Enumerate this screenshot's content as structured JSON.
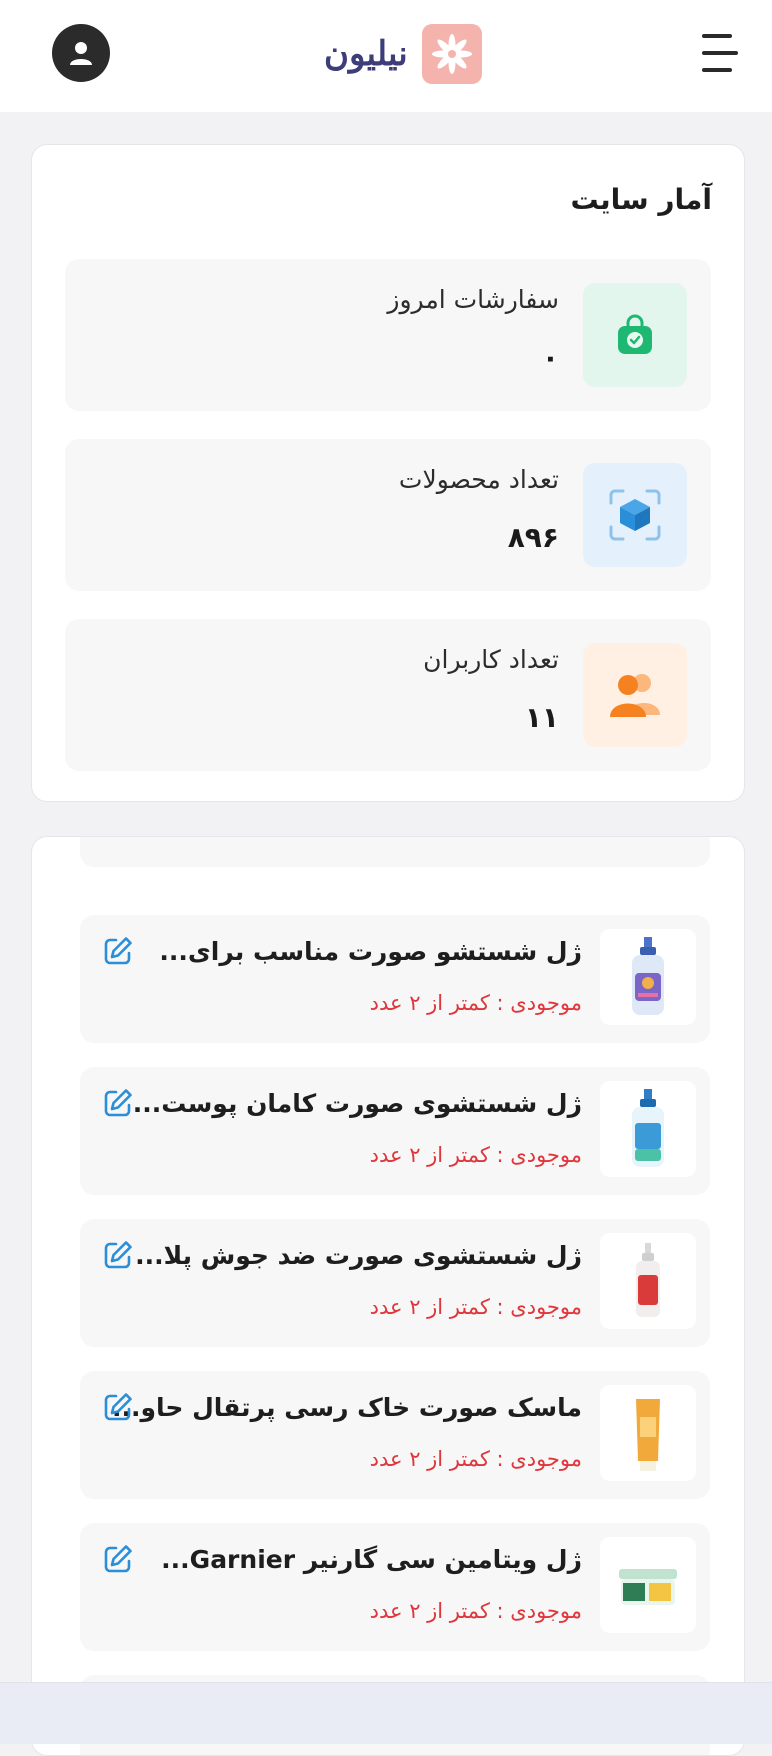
{
  "header": {
    "logo_text": "نیلیون"
  },
  "stats": {
    "title": "آمار سایت",
    "items": [
      {
        "label": "سفارشات امروز",
        "value": "۰",
        "icon": "shopping-bag-check-icon",
        "color": "#1fb873",
        "bg": "#e3f6ed"
      },
      {
        "label": "تعداد محصولات",
        "value": "۸۹۶",
        "icon": "box-icon",
        "color": "#2a8ed8",
        "bg": "#e4f0fb"
      },
      {
        "label": "تعداد کاربران",
        "value": "۱۱",
        "icon": "users-icon",
        "color": "#f58220",
        "bg": "#fff0e3"
      }
    ]
  },
  "low_stock": {
    "products": [
      {
        "name": "ژل شستشو صورت مناسب برای...",
        "stock": "موجودی : کمتر از ۲ عدد"
      },
      {
        "name": "ژل شستشوی صورت کامان پوست...",
        "stock": "موجودی : کمتر از ۲ عدد"
      },
      {
        "name": "ژل شستشوی صورت ضد جوش پلا...",
        "stock": "موجودی : کمتر از ۲ عدد"
      },
      {
        "name": "ماسک صورت خاک رسی پرتقال حاو...",
        "stock": "موجودی : کمتر از ۲ عدد"
      },
      {
        "name": "ژل ویتامین سی گارنیر Garnier...",
        "stock": "موجودی : کمتر از ۲ عدد"
      }
    ]
  },
  "colors": {
    "stock_warning": "#e0353b",
    "edit_icon": "#2a8ed8",
    "logo_bg": "#f5b3ad",
    "logo_text": "#3d3d7a"
  }
}
